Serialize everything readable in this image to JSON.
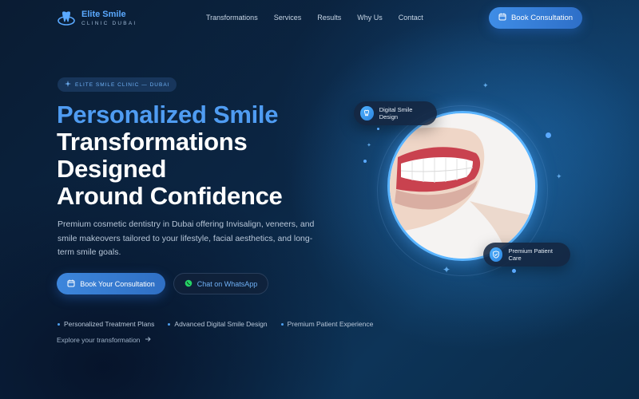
{
  "nav": {
    "logo_name": "Elite Smile",
    "logo_sub": "CLINIC DUBAI",
    "links": [
      "Transformations",
      "Services",
      "Results",
      "Why Us",
      "Contact"
    ],
    "cta_label": "Book Consultation"
  },
  "hero": {
    "badge": "ELITE SMILE CLINIC — DUBAI",
    "headline_accent": "Personalized Smile",
    "headline_lines": [
      "Transformations",
      "Designed",
      "Around Confidence"
    ],
    "description": "Premium cosmetic dentistry in Dubai offering Invisalign, veneers, and smile makeovers tailored to your lifestyle, facial aesthetics, and long-term smile goals.",
    "primary_button": "Book Your Consultation",
    "secondary_button": "Chat on WhatsApp",
    "features": [
      "Personalized Treatment Plans",
      "Advanced Digital Smile Design",
      "Premium Patient Experience"
    ],
    "explore_link": "Explore your transformation"
  },
  "visual": {
    "card_top": "Digital Smile Design",
    "card_bottom": "Premium Patient Care"
  },
  "colors": {
    "accent": "#4f9cf2",
    "button": "#3d86dc",
    "background": "#0b2644",
    "whatsapp": "#25d366"
  },
  "icons": {
    "logo": "tooth-logo-icon",
    "calendar": "calendar-icon",
    "whatsapp": "whatsapp-icon",
    "arrow": "arrow-right-icon",
    "sparkle": "sparkle-icon",
    "smile_design": "tooth-scan-icon",
    "patient_care": "shield-check-icon"
  }
}
